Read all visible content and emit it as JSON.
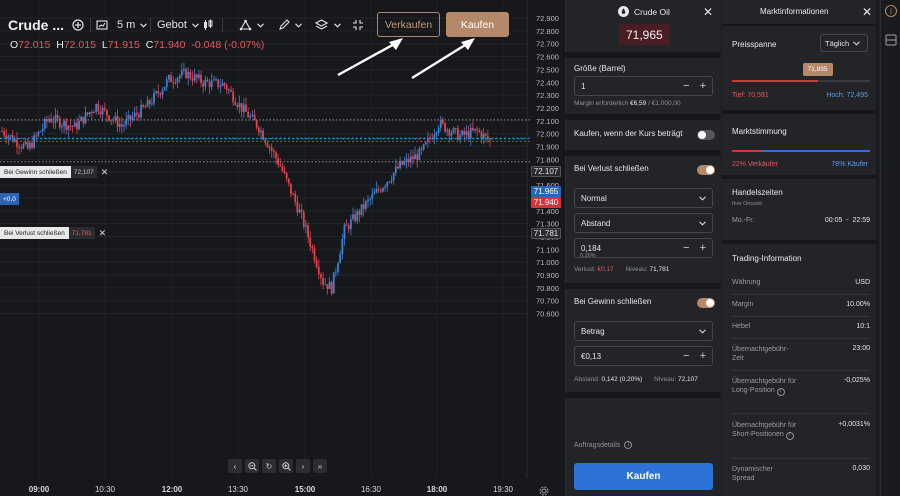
{
  "chart": {
    "symbol": "Crude ...",
    "interval": "5 m",
    "price_type": "Gebot",
    "ohlc": {
      "o_label": "O",
      "o": "72.015",
      "h_label": "H",
      "h": "72.015",
      "l_label": "L",
      "l": "71.915",
      "c_label": "C",
      "c": "71.940",
      "change": "-0.048 (-0.07%)"
    },
    "sell_label": "Verkaufen",
    "buy_label": "Kaufen",
    "take_profit_tag": {
      "label": "Bei Gewinn schließen",
      "value": "72,107"
    },
    "stop_loss_tag": {
      "label": "Bei Verlust schließen",
      "value": "71,781"
    },
    "position_tag": "+0,0",
    "price_tags": {
      "take_profit": "72.107",
      "ask": "71.965",
      "bid": "71.940",
      "stop_loss": "71.781"
    },
    "colors": {
      "up": "#3b82d6",
      "down": "#e0434c",
      "accent": "#b4896a"
    }
  },
  "chart_data": {
    "type": "candlestick",
    "y_ticks": [
      "72.900",
      "72.800",
      "72.700",
      "72.600",
      "72.500",
      "72.400",
      "72.300",
      "72.200",
      "72.100",
      "72.000",
      "71.900",
      "71.800",
      "71.700",
      "71.600",
      "71.500",
      "71.400",
      "71.300",
      "71.200",
      "71.100",
      "71.000",
      "70.900",
      "70.800",
      "70.700",
      "70.600"
    ],
    "x_ticks": [
      "09:00",
      "10:30",
      "12:00",
      "13:30",
      "15:00",
      "16:30",
      "18:00",
      "19:30"
    ],
    "ylim": [
      70.6,
      72.9
    ],
    "waypoints": [
      {
        "t": 0,
        "p": 72.02
      },
      {
        "t": 12,
        "p": 71.88
      },
      {
        "t": 22,
        "p": 72.12
      },
      {
        "t": 34,
        "p": 72.05
      },
      {
        "t": 44,
        "p": 72.22
      },
      {
        "t": 56,
        "p": 72.06
      },
      {
        "t": 68,
        "p": 72.22
      },
      {
        "t": 78,
        "p": 72.42
      },
      {
        "t": 86,
        "p": 72.47
      },
      {
        "t": 94,
        "p": 72.4
      },
      {
        "t": 104,
        "p": 72.38
      },
      {
        "t": 112,
        "p": 72.2
      },
      {
        "t": 120,
        "p": 72.05
      },
      {
        "t": 130,
        "p": 71.75
      },
      {
        "t": 140,
        "p": 71.35
      },
      {
        "t": 150,
        "p": 70.85
      },
      {
        "t": 154,
        "p": 70.8
      },
      {
        "t": 160,
        "p": 71.25
      },
      {
        "t": 170,
        "p": 71.45
      },
      {
        "t": 178,
        "p": 71.6
      },
      {
        "t": 186,
        "p": 71.75
      },
      {
        "t": 196,
        "p": 71.85
      },
      {
        "t": 204,
        "p": 72.08
      },
      {
        "t": 214,
        "p": 71.98
      },
      {
        "t": 222,
        "p": 72.02
      },
      {
        "t": 228,
        "p": 71.94
      }
    ],
    "candle_count": 229
  },
  "order": {
    "instrument": "Crude Oil",
    "price": "71,965",
    "size_label": "Größe (Barrel)",
    "size_value": "1",
    "margin_label": "Margin erforderlich",
    "margin_value": "€6,59",
    "margin_total": "/ €1.000,00",
    "conditional_label": "Kaufen, wenn der Kurs beträgt",
    "stop_loss_label": "Bei Verlust schließen",
    "stop_type": "Normal",
    "stop_mode": "Abstand",
    "stop_value": "0,184",
    "stop_pct": "0,26%",
    "loss_label": "Verlust:",
    "loss_value": "€0,17",
    "stop_level_label": "Niveau:",
    "stop_level_value": "71,781",
    "take_profit_label": "Bei Gewinn schließen",
    "tp_mode": "Betrag",
    "tp_value": "€0,13",
    "tp_distance_label": "Abstand:",
    "tp_distance_value": "0,142 (0,20%)",
    "tp_level_label": "Niveau:",
    "tp_level_value": "72,107",
    "details_label": "Auftragsdetails",
    "submit_label": "Kaufen"
  },
  "market": {
    "title": "Marktinformationen",
    "range_label": "Preisspanne",
    "range_period": "Täglich",
    "range_current": "71,935",
    "range_current_fraction": 0.62,
    "low_label": "Tief:",
    "low_value": "70,591",
    "high_label": "Hoch:",
    "high_value": "72,495",
    "sentiment_label": "Marktstimmung",
    "sellers": "22% Verkäufer",
    "buyers": "78% Käufer",
    "sellers_fraction": 0.22,
    "hours_label": "Handelszeiten",
    "hours_sub": "Ihre Ortszeit",
    "hours_days": "Mo.-Fr.",
    "hours_value": "00:05  -  22:59",
    "trading_info_label": "Trading-Information",
    "info_rows": [
      {
        "label": "Währung",
        "value": "USD"
      },
      {
        "label": "Margin",
        "value": "10.00%"
      },
      {
        "label": "Hebel",
        "value": "10:1"
      },
      {
        "label": "Übernachtgebühr-Zeit",
        "value": "23:00"
      },
      {
        "label": "Übernachtgebühr für Long-Position",
        "value": "-0,025%"
      },
      {
        "label": "Übernachtgebühr für Short-Positionen",
        "value": "+0,0031%"
      },
      {
        "label": "Dynamischer Spread",
        "value": "0,030"
      }
    ]
  }
}
